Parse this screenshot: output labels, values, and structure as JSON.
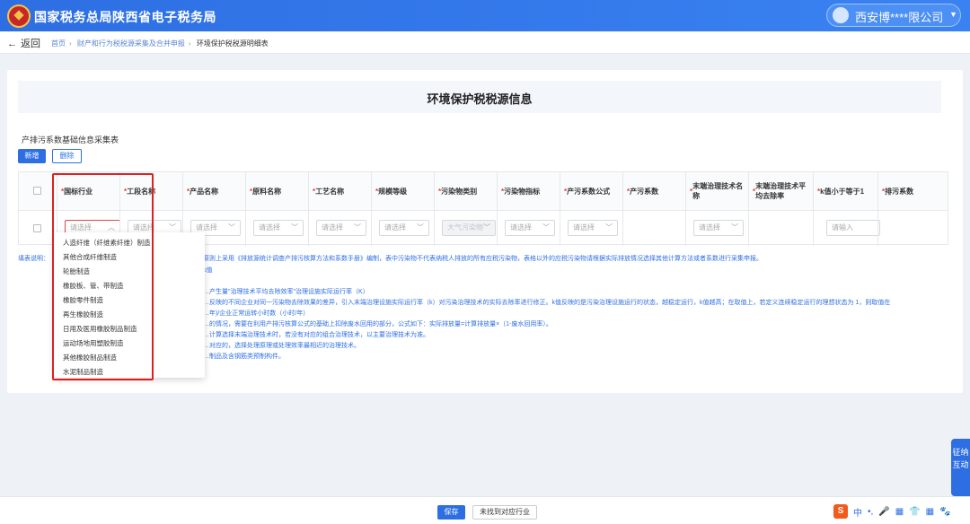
{
  "header": {
    "site_title": "国家税务总局陕西省电子税务局",
    "user_name": "西安博****限公司"
  },
  "nav": {
    "back_label": "返回",
    "breadcrumbs": [
      "首页",
      "财产和行为税税源采集及合并申报",
      "环境保护税税源明细表"
    ]
  },
  "page": {
    "title": "环境保护税税源信息",
    "section_title": "产排污系数基础信息采集表",
    "add_label": "新增",
    "delete_label": "删除"
  },
  "table": {
    "columns": [
      "*国标行业",
      "*工段名称",
      "*产品名称",
      "*原料名称",
      "*工艺名称",
      "*规模等级",
      "*污染物类别",
      "*污染物指标",
      "*产污系数公式",
      "*产污系数",
      "*末端治理技术名称",
      "*末端治理技术平均去除率",
      "*k值小于等于1",
      "*排污系数"
    ],
    "placeholders": {
      "select": "请选择",
      "input": "请输入",
      "pollutant_category": "大气污染物"
    }
  },
  "notes": [
    "填表说明：",
    "原则上采用《排放源统计调查产排污核算方法和系数手册》编制，表中污染物不代表纳税人排放的所有应税污染物，表格以外的应税污染物请根据实际排放情况选择其他计算方法或者系数进行采集申报。",
    "k值",
    "…产生量\"治理技术平均去除效率\"治理设施实际运行率（K）",
    "…反映的不同企业对同一污染物去除效果的差异，引入末端治理设施实际运行率（k）对污染治理技术的实际去除率进行修正。k值反映的是污染治理设施运行的状态，越稳定运行，k值越高；在取值上，若定义连续稳定运行的理想状态为 1，则取值在",
    "…年)/企业正常运转小时数（小时/年）",
    "…的情况，需要在利用产排污核算公式的基础上扣除废水回用的部分，公式如下：实际排放量=计算排放量×（1-废水回用率）。",
    "…计算选择末端治理技术时，若没有对应的组合治理技术，以主要治理技术为准。",
    "…对应的，选择处理原理或处理效率最相近的治理技术。",
    "…制品及含钢筋类预制构件。"
  ],
  "dropdown": {
    "items": [
      "人造纤维（纤维素纤维）制造",
      "其他合成纤维制造",
      "轮胎制造",
      "橡胶板、管、带制造",
      "橡胶零件制造",
      "再生橡胶制造",
      "日用及医用橡胶制品制造",
      "运动场地用塑胶制造",
      "其他橡胶制品制造",
      "水泥制品制造"
    ]
  },
  "footer": {
    "save_label": "保存",
    "not_found_label": "未找到对应行业"
  },
  "side_widget": {
    "label": "征纳互动"
  },
  "ime": {
    "s_label": "S",
    "items": [
      "中",
      "•,",
      "🎤",
      "▦",
      "👕",
      "▦",
      "🐾"
    ]
  },
  "colors": {
    "primary": "#2d6fe3",
    "highlight": "#e02020"
  }
}
